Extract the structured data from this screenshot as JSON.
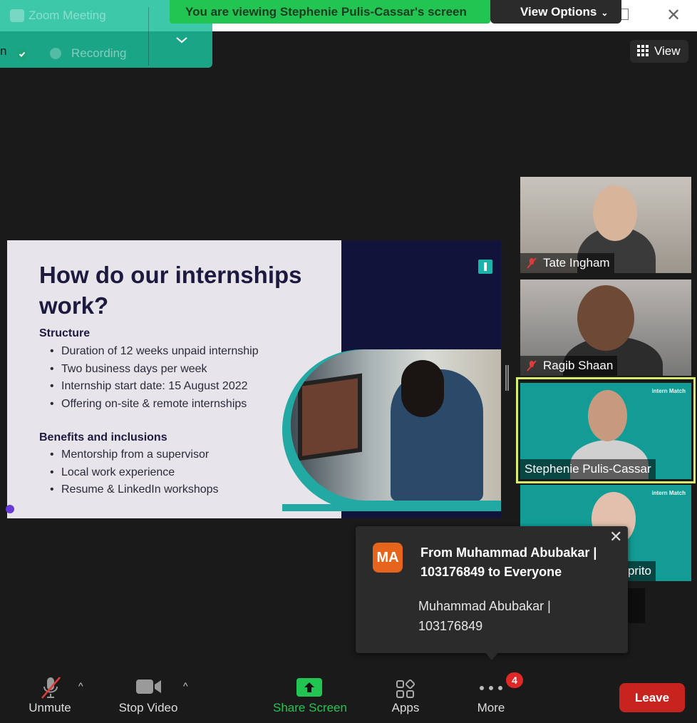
{
  "window": {
    "close_glyph": "✕"
  },
  "banner": {
    "text": "You are viewing Stephenie Pulis-Cassar's screen",
    "view_options": "View Options"
  },
  "meeting_info": {
    "title": "Zoom Meeting",
    "recording": "Recording",
    "partial_letter": "n"
  },
  "view_button": {
    "label": "View"
  },
  "slide": {
    "title": "How do our internships work?",
    "section1": {
      "heading": "Structure",
      "items": [
        "Duration of 12 weeks unpaid internship",
        "Two business days per week",
        "Internship start date: 15 August 2022",
        "Offering on-site & remote internships"
      ]
    },
    "section2": {
      "heading": "Benefits and inclusions",
      "items": [
        "Mentorship from a supervisor",
        "Local work experience",
        "Resume & LinkedIn workshops"
      ]
    }
  },
  "participants": [
    {
      "name": "Tate Ingham",
      "muted": true
    },
    {
      "name": "Ragib Shaan",
      "muted": true
    },
    {
      "name": "Stephenie Pulis-Cassar",
      "muted": false,
      "active": true,
      "brand": "intern Match"
    },
    {
      "name": "prito",
      "muted": false,
      "brand": "intern Match"
    }
  ],
  "notification": {
    "avatar_initials": "MA",
    "from": "From Muhammad Abubakar | 103176849 to Everyone",
    "message": "Muhammad Abubakar | 103176849",
    "close_glyph": "✕"
  },
  "toolbar": {
    "unmute": "Unmute",
    "stop_video": "Stop Video",
    "share_screen": "Share Screen",
    "apps": "Apps",
    "more": "More",
    "more_badge": "4",
    "leave": "Leave",
    "caret": "^"
  },
  "colors": {
    "accent_green": "#23c552",
    "leave_red": "#c8241f",
    "active_speaker": "#d8f06b",
    "avatar_orange": "#e6641b"
  }
}
